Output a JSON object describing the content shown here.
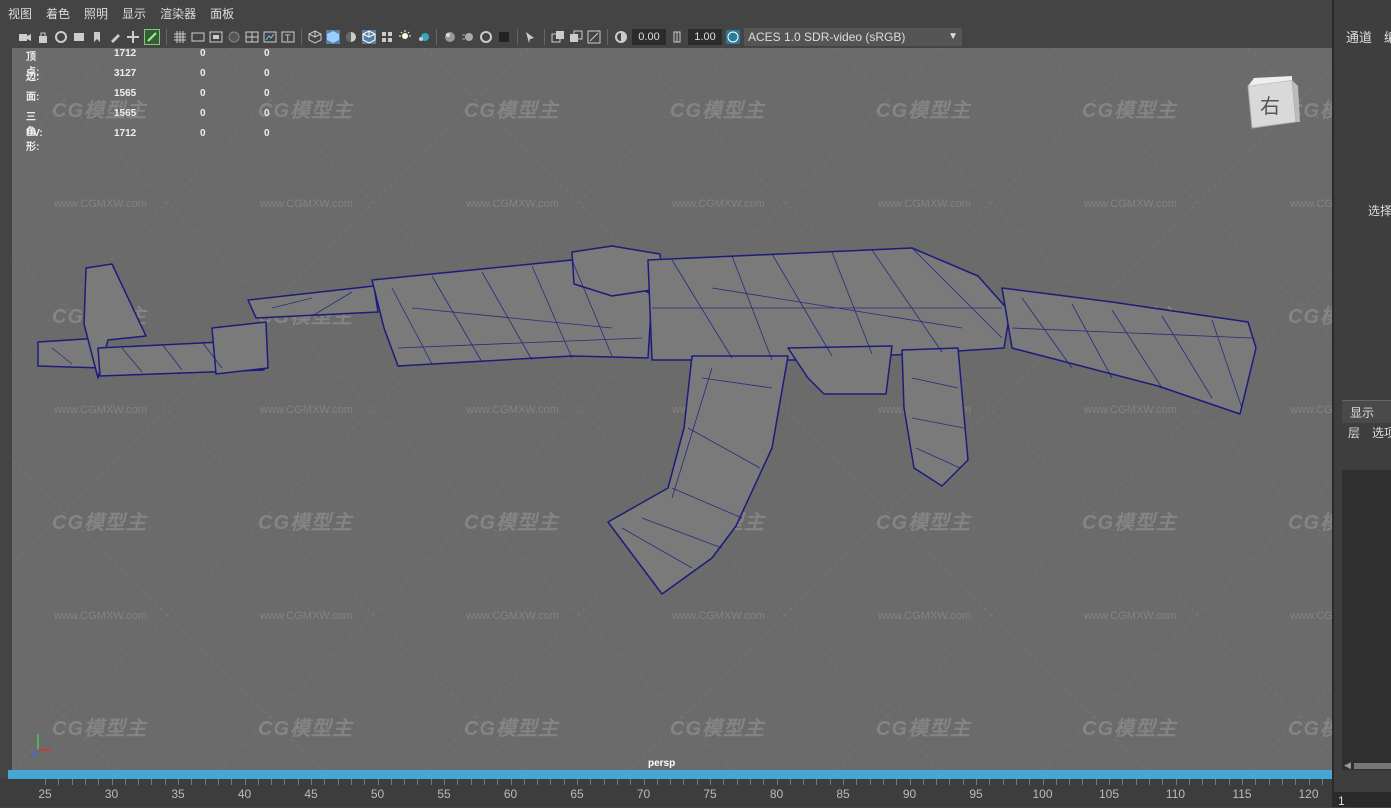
{
  "menu": [
    "视图",
    "着色",
    "照明",
    "显示",
    "渲染器",
    "面板"
  ],
  "toolbar": {
    "exposure": "0.00",
    "gamma": "1.00",
    "color_space": "ACES 1.0 SDR-video (sRGB)"
  },
  "hud": {
    "rows": [
      {
        "label": "顶点:",
        "v1": "1712",
        "v2": "0",
        "v3": "0"
      },
      {
        "label": "边:",
        "v1": "3127",
        "v2": "0",
        "v3": "0"
      },
      {
        "label": "面:",
        "v1": "1565",
        "v2": "0",
        "v3": "0"
      },
      {
        "label": "三角形:",
        "v1": "1565",
        "v2": "0",
        "v3": "0"
      },
      {
        "label": "UV:",
        "v1": "1712",
        "v2": "0",
        "v3": "0"
      }
    ]
  },
  "viewcube_label": "右",
  "camera_label": "persp",
  "watermark": {
    "logo": "CG模型主",
    "url": "www.CGMXW.com"
  },
  "timeline": {
    "ticks": [
      "25",
      "30",
      "35",
      "40",
      "45",
      "50",
      "55",
      "60",
      "65",
      "70",
      "75",
      "80",
      "85",
      "90",
      "95",
      "100",
      "105",
      "110",
      "115",
      "120"
    ]
  },
  "right_panel": {
    "channel": "通道",
    "channel_cut": "编",
    "select": "选择",
    "display": "显示",
    "layer": "层",
    "options": "选项",
    "frame": "1"
  },
  "colors": {
    "viewport_bg": "#6b6b6b",
    "wire": "#1c1c7a",
    "timeline_accent": "#46a7d6"
  }
}
